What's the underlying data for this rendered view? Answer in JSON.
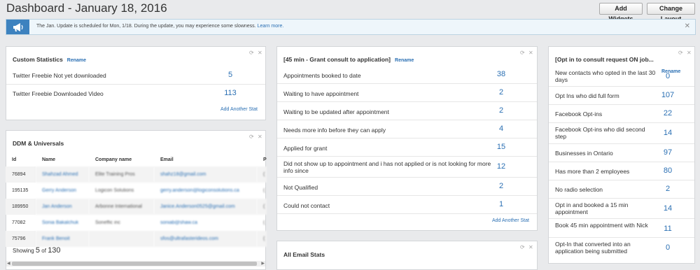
{
  "header": {
    "title": "Dashboard - January 18, 2016",
    "add_widgets": "Add Widgets",
    "change_layout": "Change Layout"
  },
  "notice": {
    "message": "The Jan. Update is scheduled for Mon, 1/18. During the update, you may experience some slowness.",
    "link": "Learn more."
  },
  "custom_stats": {
    "title": "Custom Statistics",
    "rename": "Rename",
    "rows": [
      {
        "label": "Twitter Freebie Not yet downloaded",
        "value": "5"
      },
      {
        "label": "Twitter Freebie Downloaded Video",
        "value": "113"
      }
    ],
    "add_stat": "Add Another Stat"
  },
  "ddm": {
    "title": "DDM & Universals",
    "columns": [
      "Id",
      "Name",
      "Company name",
      "Email",
      "P"
    ],
    "rows": [
      {
        "id": "76894",
        "name": "Shahzad Ahmed",
        "company": "Elite Training Pros",
        "email": "shahz18@gmail.com",
        "extra": "("
      },
      {
        "id": "195135",
        "name": "Gerry Anderson",
        "company": "Logicon Solutions",
        "email": "gerry.anderson@logiconsolutions.ca",
        "extra": "("
      },
      {
        "id": "189950",
        "name": "Jan Anderson",
        "company": "Arbonne International",
        "email": "Janice.Anderson0525@gmail.com",
        "extra": "("
      },
      {
        "id": "77082",
        "name": "Sonia Bakalchuk",
        "company": "Soneffic inc",
        "email": "soniab@shaw.ca",
        "extra": "("
      },
      {
        "id": "75796",
        "name": "Frank Benoit",
        "company": "",
        "email": "sfos@ultrafasterideos.com",
        "extra": "("
      }
    ],
    "showing_prefix": "Showing",
    "showing_count": "5",
    "showing_of": "of",
    "showing_total": "130"
  },
  "consult": {
    "title": "[45 min - Grant consult to application]",
    "rename": "Rename",
    "rows": [
      {
        "label": "Appointments booked to date",
        "value": "38"
      },
      {
        "label": "Waiting to have appointment",
        "value": "2"
      },
      {
        "label": "Waiting to be updated after appointment",
        "value": "2"
      },
      {
        "label": "Needs more info before they can apply",
        "value": "4"
      },
      {
        "label": "Applied for grant",
        "value": "15"
      },
      {
        "label": "Did not show up to appointment and i has not applied or is not looking for more info since",
        "value": "12"
      },
      {
        "label": "Not Qualified",
        "value": "2"
      },
      {
        "label": "Could not contact",
        "value": "1"
      }
    ],
    "add_stat": "Add Another Stat"
  },
  "email_stats": {
    "title": "All Email Stats"
  },
  "optin": {
    "title": "[Opt in to consult request ON job...",
    "rename": "Rename",
    "rows": [
      {
        "label": "New contacts who opted in the last 30 days",
        "value": "0"
      },
      {
        "label": "Opt Ins who did full form",
        "value": "107"
      },
      {
        "label": "Facebook Opt-ins",
        "value": "22"
      },
      {
        "label": "Facebook Opt-ins who did second step",
        "value": "14"
      },
      {
        "label": "Businesses in Ontario",
        "value": "97"
      },
      {
        "label": "Has more than 2 employees",
        "value": "80"
      },
      {
        "label": "No radio selection",
        "value": "2"
      },
      {
        "label": "Opt in and booked a 15 min appointment",
        "value": "14"
      },
      {
        "label": "Book 45 min appointment with Nick",
        "value": "11"
      },
      {
        "label": "Opt-In that converted into an application being submitted",
        "value": "0"
      }
    ]
  },
  "icons": [
    "megaphone-icon",
    "refresh-icon",
    "close-icon"
  ],
  "colors": {
    "accent": "#2a6fb3",
    "banner": "#3d82bf",
    "page_bg": "#e9eaec"
  }
}
